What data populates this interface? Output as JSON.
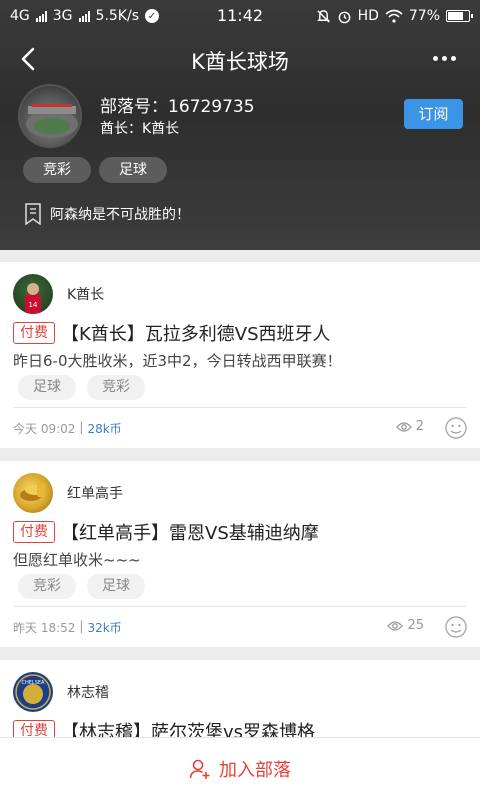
{
  "status_bar": {
    "net1": "4G",
    "net2": "3G",
    "speed": "5.5K/s",
    "time": "11:42",
    "hd": "HD",
    "battery": "77%"
  },
  "header": {
    "title": "K酋长球场",
    "tribe_id": "部落号：16729735",
    "chief": "酋长：K酋长",
    "subscribe_label": "订阅",
    "tags": [
      "竞彩",
      "足球"
    ],
    "motto": "阿森纳是不可战胜的！"
  },
  "posts": [
    {
      "author": "K酋长",
      "badge": "付费",
      "title": "【K酋长】瓦拉多利德VS西班牙人",
      "summary": "昨日6-0大胜收米，近3中2，今日转战西甲联赛！",
      "tags": [
        "足球",
        "竞彩"
      ],
      "time": "今天 09:02",
      "sep": "|",
      "price": "28k币",
      "views": "2"
    },
    {
      "author": "红单高手",
      "badge": "付费",
      "title": "【红单高手】雷恩VS基辅迪纳摩",
      "summary": "但愿红单收米~~~",
      "tags": [
        "竞彩",
        "足球"
      ],
      "time": "昨天 18:52",
      "sep": "|",
      "price": "32k币",
      "views": "25"
    },
    {
      "author": "林志稽",
      "badge": "付费",
      "title": "【林志稽】萨尔茨堡vs罗森博格"
    }
  ],
  "bottom": {
    "join_label": "加入部落"
  },
  "colors": {
    "accent_red": "#e0433a",
    "subscribe_blue": "#3b94e6",
    "header_bg": "#333333"
  }
}
